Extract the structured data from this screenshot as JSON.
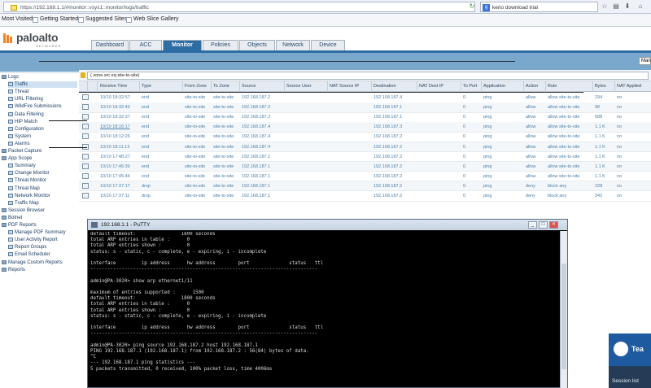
{
  "browser": {
    "url": "https://192.168.1.1/#monitor::vsys1::monitor/logs/traffic",
    "search_text": "kerio download trial",
    "bookmarks": [
      "Most Visited",
      "Getting Started",
      "Suggested Sites",
      "Web Slice Gallery"
    ]
  },
  "brand": {
    "logo": "paloalto",
    "sub": "NETWORKS"
  },
  "tabs": [
    "Dashboard",
    "ACC",
    "Monitor",
    "Policies",
    "Objects",
    "Network",
    "Device"
  ],
  "active_tab": "Monitor",
  "subhead": {
    "manual_label": "Man"
  },
  "nav": [
    {
      "label": "Logs",
      "indent": 1
    },
    {
      "label": "Traffic",
      "indent": 2
    },
    {
      "label": "Threat",
      "indent": 2
    },
    {
      "label": "URL Filtering",
      "indent": 2
    },
    {
      "label": "WildFire Submissions",
      "indent": 2
    },
    {
      "label": "Data Filtering",
      "indent": 2
    },
    {
      "label": "HIP Match",
      "indent": 2
    },
    {
      "label": "Configuration",
      "indent": 2
    },
    {
      "label": "System",
      "indent": 2
    },
    {
      "label": "Alarms",
      "indent": 2
    },
    {
      "label": "Packet Capture",
      "indent": 1
    },
    {
      "label": "App Scope",
      "indent": 1
    },
    {
      "label": "Summary",
      "indent": 2
    },
    {
      "label": "Change Monitor",
      "indent": 2
    },
    {
      "label": "Threat Monitor",
      "indent": 2
    },
    {
      "label": "Threat Map",
      "indent": 2
    },
    {
      "label": "Network Monitor",
      "indent": 2
    },
    {
      "label": "Traffic Map",
      "indent": 2
    },
    {
      "label": "Session Browser",
      "indent": 1
    },
    {
      "label": "Botnet",
      "indent": 1
    },
    {
      "label": "PDF Reports",
      "indent": 1
    },
    {
      "label": "Manage PDF Summary",
      "indent": 2
    },
    {
      "label": "User Activity Report",
      "indent": 2
    },
    {
      "label": "Report Groups",
      "indent": 2
    },
    {
      "label": "Email Scheduler",
      "indent": 2
    },
    {
      "label": "Manage Custom Reports",
      "indent": 1
    },
    {
      "label": "Reports",
      "indent": 1
    }
  ],
  "filter": "( zone.src eq site-to-site)",
  "columns": [
    "Receive Time",
    "Type",
    "From Zone",
    "To Zone",
    "Source",
    "Source User",
    "NAT Source IP",
    "Destination",
    "NAT Dest IP",
    "To Port",
    "Application",
    "Action",
    "Rule",
    "Bytes",
    "NAT Applied"
  ],
  "rows": [
    [
      "10/10 18:32:57",
      "end",
      "site-to-site",
      "site-to-site",
      "192.168.187.2",
      "",
      "",
      "192.168.187.4",
      "",
      "0",
      "ping",
      "allow",
      "allow site-to-site",
      "294",
      "no"
    ],
    [
      "10/10 18:32:43",
      "end",
      "site-to-site",
      "site-to-site",
      "192.168.187.2",
      "",
      "",
      "192.168.187.1",
      "",
      "0",
      "ping",
      "allow",
      "allow site-to-site",
      "98",
      "no"
    ],
    [
      "10/10 18:32:37",
      "end",
      "site-to-site",
      "site-to-site",
      "192.168.187.2",
      "",
      "",
      "192.168.187.1",
      "",
      "0",
      "ping",
      "allow",
      "allow site-to-site",
      "588",
      "no"
    ],
    [
      "10/10 18:16:17",
      "end",
      "site-to-site",
      "site-to-site",
      "192.168.187.4",
      "",
      "",
      "192.168.187.3",
      "",
      "0",
      "ping",
      "allow",
      "allow site-to-site",
      "1.1 K",
      "no"
    ],
    [
      "10/10 18:12:26",
      "end",
      "site-to-site",
      "site-to-site",
      "192.168.187.4",
      "",
      "",
      "192.168.187.2",
      "",
      "0",
      "ping",
      "allow",
      "allow site-to-site",
      "1.1 K",
      "no"
    ],
    [
      "10/10 18:11:13",
      "end",
      "site-to-site",
      "site-to-site",
      "192.168.187.4",
      "",
      "",
      "192.168.187.2",
      "",
      "0",
      "ping",
      "allow",
      "allow site-to-site",
      "1.1 K",
      "no"
    ],
    [
      "10/10 17:48:27",
      "end",
      "site-to-site",
      "site-to-site",
      "192.168.187.1",
      "",
      "",
      "192.168.187.2",
      "",
      "0",
      "ping",
      "allow",
      "allow site-to-site",
      "1.1 K",
      "no"
    ],
    [
      "10/10 17:46:39",
      "end",
      "site-to-site",
      "site-to-site",
      "192.168.187.1",
      "",
      "",
      "192.168.187.2",
      "",
      "0",
      "ping",
      "allow",
      "allow site-to-site",
      "1.1 K",
      "no"
    ],
    [
      "10/10 17:45:44",
      "end",
      "site-to-site",
      "site-to-site",
      "192.168.187.1",
      "",
      "",
      "192.168.187.2",
      "",
      "0",
      "ping",
      "allow",
      "allow site-to-site",
      "1.1 K",
      "no"
    ],
    [
      "10/10 17:37:17",
      "drop",
      "site-to-site",
      "site-to-site",
      "192.168.187.1",
      "",
      "",
      "192.168.187.2",
      "",
      "0",
      "ping",
      "deny",
      "block any",
      "228",
      "no"
    ],
    [
      "10/10 17:37:11",
      "drop",
      "site-to-site",
      "site-to-site",
      "192.168.187.1",
      "",
      "",
      "192.168.187.2",
      "",
      "0",
      "ping",
      "deny",
      "block any",
      "342",
      "no"
    ]
  ],
  "putty": {
    "title": "192.168.1.1 - PuTTY",
    "lines": [
      "default timeout:                1800 seconds",
      "total ARP entries in table :      0",
      "total ARP entries shown :         0",
      "status: s - static, c - complete, e - expiring, i - incomplete",
      "",
      "interface         ip address      hw address        port              status   ttl",
      "--------------------------------------------------------------------------------",
      "",
      "admin@PA-3020> show arp ethernet1/11",
      "",
      "maximum of entries supported :      1500",
      "default timeout:                1800 seconds",
      "total ARP entries in table :      0",
      "total ARP entries shown :         0",
      "status: s - static, c - complete, e - expiring, i - incomplete",
      "",
      "interface         ip address      hw address        port              status   ttl",
      "--------------------------------------------------------------------------------",
      "",
      "admin@PA-3020> ping source 192.168.187.2 host 192.168.187.1",
      "PING 192.168.187.1 (192.168.187.1) from 192.168.187.2 : 56(84) bytes of data.",
      "^C",
      "--- 192.168.187.1 ping statistics ---",
      "5 packets transmitted, 0 received, 100% packet loss, time 4006ms"
    ]
  },
  "teamviewer": {
    "brand": "Tea",
    "session_list": "Session list"
  }
}
